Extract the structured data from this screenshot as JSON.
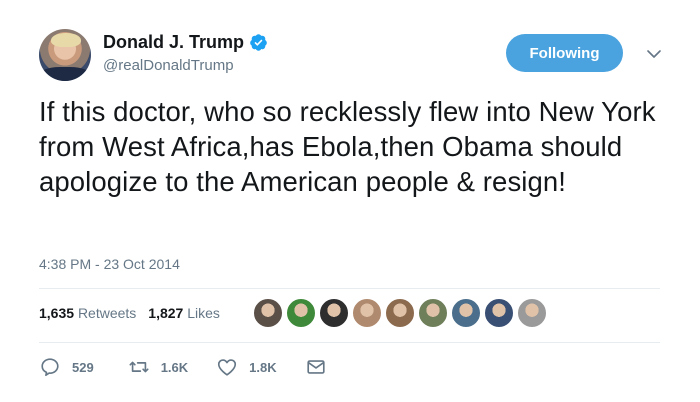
{
  "user": {
    "display_name": "Donald J. Trump",
    "handle": "@realDonaldTrump",
    "verified": true
  },
  "follow_button": {
    "label": "Following"
  },
  "tweet": {
    "text": "If this doctor, who so recklessly flew into New York from West Africa,has Ebola,then Obama should apologize to the American people & resign!",
    "timestamp": "4:38 PM - 23 Oct 2014"
  },
  "stats": {
    "retweets_count": "1,635",
    "retweets_label": "Retweets",
    "likes_count": "1,827",
    "likes_label": "Likes"
  },
  "likers": [
    {
      "color": "#5b5048"
    },
    {
      "color": "#3f8a3a"
    },
    {
      "color": "#2e2e2e"
    },
    {
      "color": "#b08a6e"
    },
    {
      "color": "#8c6a4e"
    },
    {
      "color": "#6f7f5a"
    },
    {
      "color": "#4a6e8c"
    },
    {
      "color": "#3a4f74"
    },
    {
      "color": "#9a9a9a"
    }
  ],
  "actions": {
    "reply_count": "529",
    "retweet_count": "1.6K",
    "like_count": "1.8K"
  },
  "icons": {
    "verified": "verified-badge-icon",
    "caret": "chevron-down-icon",
    "reply": "reply-icon",
    "retweet": "retweet-icon",
    "like": "heart-icon",
    "dm": "envelope-icon"
  },
  "colors": {
    "accent": "#1da1f2",
    "follow_button": "#4aa3df",
    "secondary_text": "#657786"
  }
}
